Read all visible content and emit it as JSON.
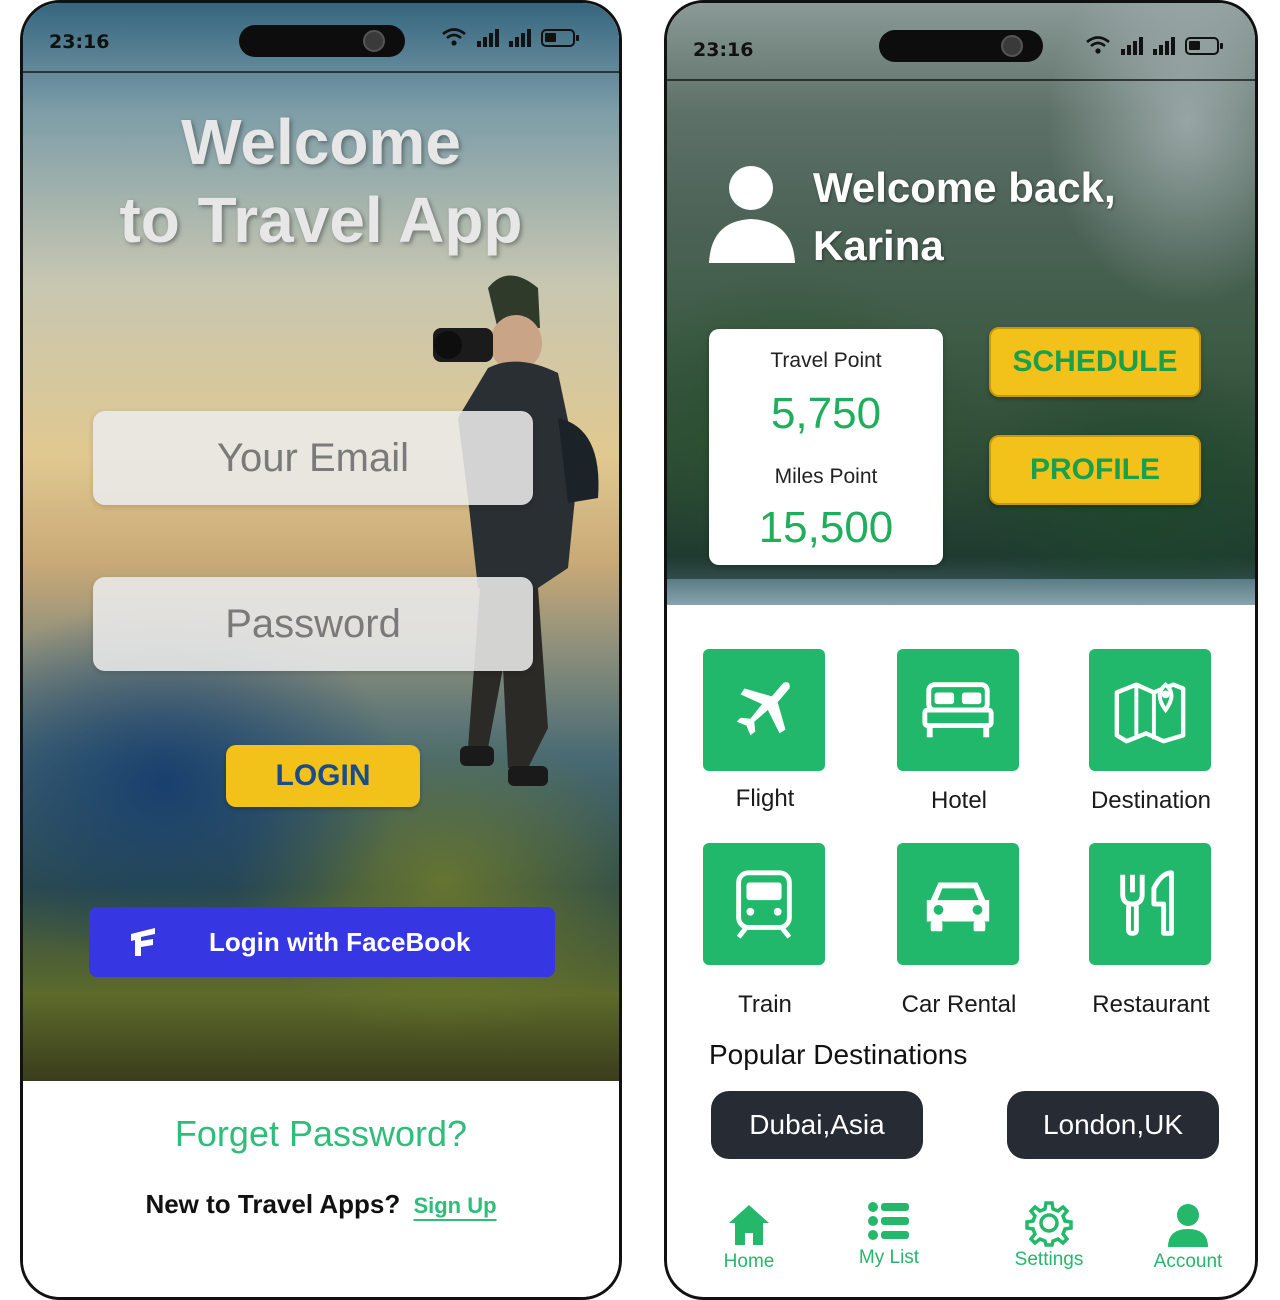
{
  "status_bar": {
    "time": "23:16"
  },
  "login": {
    "title_line1": "Welcome",
    "title_line2": "to Travel App",
    "email_placeholder": "Your Email",
    "password_placeholder": "Password",
    "login_label": "LOGIN",
    "facebook_label": "Login  with FaceBook",
    "forget_label": "Forget Password?",
    "new_user_text": "New to Travel Apps?",
    "signup_label": "Sign  Up"
  },
  "home": {
    "welcome_line1": "Welcome back,",
    "welcome_line2": "Karina",
    "travel_point_label": "Travel Point",
    "travel_point_value": "5,750",
    "miles_point_label": "Miles Point",
    "miles_point_value": "15,500",
    "schedule_label": "SCHEDULE",
    "profile_label": "PROFILE",
    "services": [
      {
        "label": "Flight",
        "icon": "airplane-icon"
      },
      {
        "label": "Hotel",
        "icon": "bed-icon"
      },
      {
        "label": "Destination",
        "icon": "map-icon"
      },
      {
        "label": "Train",
        "icon": "train-icon"
      },
      {
        "label": "Car Rental",
        "icon": "car-icon"
      },
      {
        "label": "Restaurant",
        "icon": "fork-knife-icon"
      }
    ],
    "popular_title": "Popular Destinations",
    "destinations": [
      "Dubai,Asia",
      "London,UK"
    ],
    "nav": [
      {
        "label": "Home",
        "icon": "home-icon"
      },
      {
        "label": "My List",
        "icon": "list-icon"
      },
      {
        "label": "Settings",
        "icon": "gear-icon"
      },
      {
        "label": "Account",
        "icon": "person-icon"
      }
    ]
  },
  "colors": {
    "accent_green": "#22b86c",
    "button_yellow": "#f2c21b",
    "facebook_blue": "#3636e3",
    "pill_dark": "#262b34"
  }
}
